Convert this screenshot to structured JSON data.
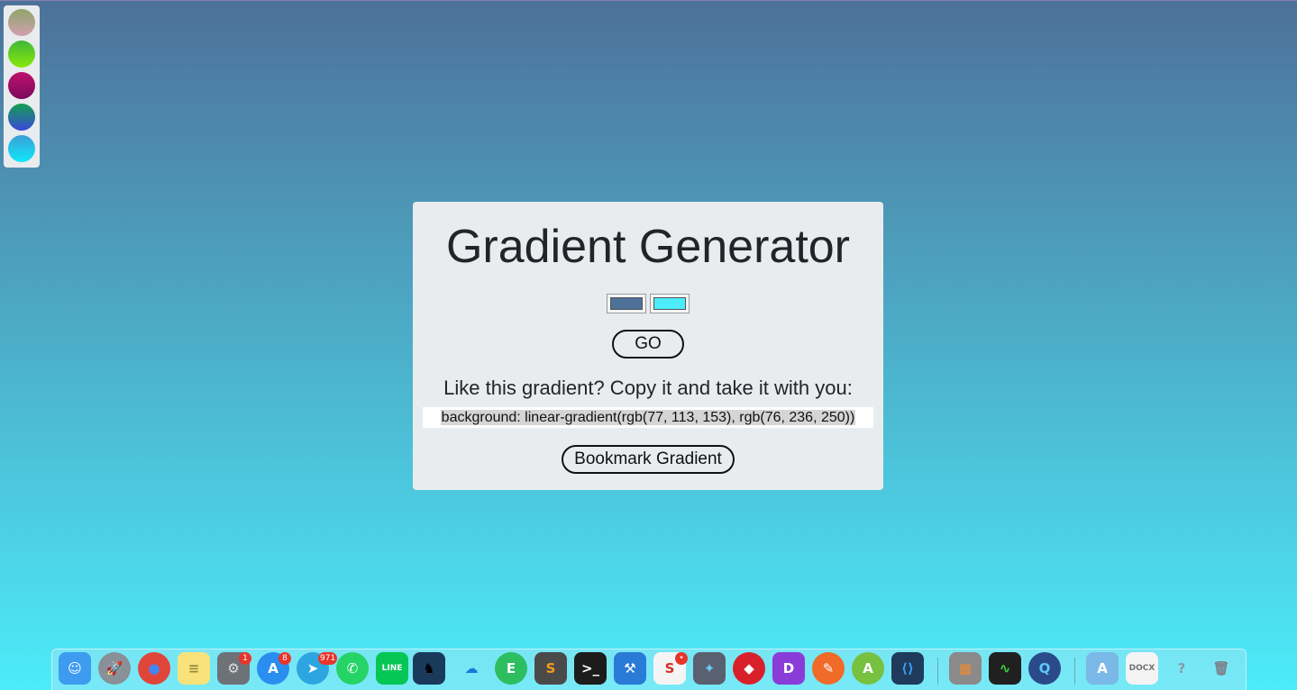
{
  "bookmarks": {
    "swatches": [
      {
        "from": "#8fa56a",
        "to": "#d0a0b0"
      },
      {
        "from": "#3fb83a",
        "to": "#8ae80a"
      },
      {
        "from": "#c0116b",
        "to": "#7a0a60"
      },
      {
        "from": "#12a052",
        "to": "#3a48d8"
      },
      {
        "from": "#3aa0d8",
        "to": "#10e8f8"
      }
    ]
  },
  "app": {
    "title": "Gradient Generator",
    "color1": "#4d7199",
    "color2": "#4cecfa",
    "go_label": "GO",
    "copy_prompt": "Like this gradient? Copy it and take it with you:",
    "css_output": "background: linear-gradient(rgb(77, 113, 153), rgb(76, 236, 250))",
    "bookmark_label": "Bookmark Gradient"
  },
  "dock": {
    "apps": [
      {
        "name": "finder-icon",
        "glyph": "☺",
        "bg": "#3d9bf0",
        "fg": "#ffffff"
      },
      {
        "name": "launchpad-icon",
        "glyph": "🚀",
        "bg": "#8a9098",
        "fg": "#ffffff",
        "round": true
      },
      {
        "name": "chrome-icon",
        "glyph": "●",
        "bg": "#e0453a",
        "fg": "#4285f4",
        "round": true
      },
      {
        "name": "notes-icon",
        "glyph": "≡",
        "bg": "#f8e27a",
        "fg": "#9a8a40"
      },
      {
        "name": "system-preferences-icon",
        "glyph": "⚙",
        "bg": "#6d7278",
        "fg": "#e0e0e0",
        "badge": "1"
      },
      {
        "name": "app-store-icon",
        "glyph": "A",
        "bg": "#2a8ef0",
        "fg": "#ffffff",
        "round": true,
        "badge": "8"
      },
      {
        "name": "telegram-icon",
        "glyph": "➤",
        "bg": "#2ca5e0",
        "fg": "#ffffff",
        "round": true,
        "badge": "971"
      },
      {
        "name": "whatsapp-icon",
        "glyph": "✆",
        "bg": "#25d366",
        "fg": "#ffffff",
        "round": true
      },
      {
        "name": "line-icon",
        "glyph": "LINE",
        "bg": "#06c755",
        "fg": "#ffffff"
      },
      {
        "name": "kindle-icon",
        "glyph": "♞",
        "bg": "#1a3a5c",
        "fg": "#000000"
      },
      {
        "name": "onedrive-icon",
        "glyph": "☁",
        "bg": "transparent",
        "fg": "#1878d8"
      },
      {
        "name": "evernote-icon",
        "glyph": "E",
        "bg": "#2dbe60",
        "fg": "#ffffff",
        "round": true
      },
      {
        "name": "sublime-text-icon",
        "glyph": "S",
        "bg": "#4a4a4a",
        "fg": "#f59d1a"
      },
      {
        "name": "terminal-icon",
        "glyph": ">_",
        "bg": "#1c1c1c",
        "fg": "#ffffff"
      },
      {
        "name": "xcode-icon",
        "glyph": "⚒",
        "bg": "#2a7ad8",
        "fg": "#ffffff"
      },
      {
        "name": "slides-icon",
        "glyph": "S",
        "bg": "#f4f4f4",
        "fg": "#d0302a",
        "badge": "•"
      },
      {
        "name": "copilot-icon",
        "glyph": "✦",
        "bg": "#5a6070",
        "fg": "#6ac8f8"
      },
      {
        "name": "bear-icon",
        "glyph": "◆",
        "bg": "#d8202a",
        "fg": "#ffffff",
        "round": true
      },
      {
        "name": "deskpad-icon",
        "glyph": "D",
        "bg": "#8a3cd8",
        "fg": "#ffffff"
      },
      {
        "name": "postman-icon",
        "glyph": "✎",
        "bg": "#f06a28",
        "fg": "#ffffff",
        "round": true
      },
      {
        "name": "android-studio-icon",
        "glyph": "A",
        "bg": "#78c040",
        "fg": "#ffffff",
        "round": true
      },
      {
        "name": "vscode-icon",
        "glyph": "⟨⟩",
        "bg": "#1f3a5a",
        "fg": "#3aa0f0"
      },
      {
        "name": "calculator-icon",
        "glyph": "▦",
        "bg": "#8a8a8a",
        "fg": "#f08a30"
      },
      {
        "name": "activity-monitor-icon",
        "glyph": "∿",
        "bg": "#202020",
        "fg": "#40d040"
      },
      {
        "name": "quicktime-icon",
        "glyph": "Q",
        "bg": "#2a4a8a",
        "fg": "#60c8f8",
        "round": true
      },
      {
        "name": "applications-folder-icon",
        "glyph": "A",
        "bg": "#7ab8e8",
        "fg": "#ffffff"
      },
      {
        "name": "document-icon",
        "glyph": "DOCX",
        "bg": "#f4f4f4",
        "fg": "#707070"
      },
      {
        "name": "help-icon",
        "glyph": "?",
        "bg": "transparent",
        "fg": "#8a9aa8"
      },
      {
        "name": "trash-icon",
        "glyph": "🗑",
        "bg": "transparent",
        "fg": "#7a8088"
      }
    ]
  }
}
